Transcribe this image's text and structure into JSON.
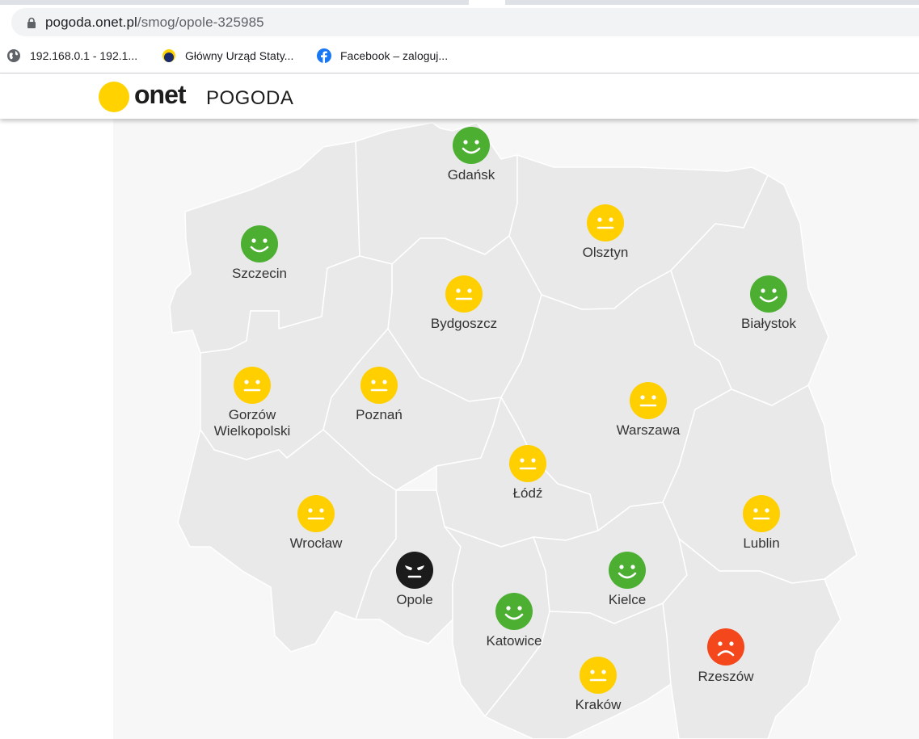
{
  "browser": {
    "url_host": "pogoda.onet.pl",
    "url_path": "/smog/opole-325985",
    "bookmarks": [
      {
        "label": "192.168.0.1 - 192.1...",
        "icon": "globe-icon"
      },
      {
        "label": "Główny Urząd Staty...",
        "icon": "gus-logo-icon"
      },
      {
        "label": "Facebook – zaloguj...",
        "icon": "facebook-icon"
      }
    ]
  },
  "header": {
    "logo_text": "onet",
    "section_title": "POGODA"
  },
  "colors": {
    "good": "#4caf32",
    "moderate": "#ffcf00",
    "bad": "#f4471c",
    "very_bad": "#1b1b1b",
    "map_fill": "#e9e9e9",
    "map_border": "#ffffff"
  },
  "map": {
    "cities": [
      {
        "id": "gdansk",
        "name": "Gdańsk",
        "quality": "good"
      },
      {
        "id": "olsztyn",
        "name": "Olsztyn",
        "quality": "moderate"
      },
      {
        "id": "szczecin",
        "name": "Szczecin",
        "quality": "good"
      },
      {
        "id": "bydgoszcz",
        "name": "Bydgoszcz",
        "quality": "moderate"
      },
      {
        "id": "bialystok",
        "name": "Białystok",
        "quality": "good"
      },
      {
        "id": "gorzow",
        "name": "Gorzów Wielkopolski",
        "quality": "moderate"
      },
      {
        "id": "poznan",
        "name": "Poznań",
        "quality": "moderate"
      },
      {
        "id": "warszawa",
        "name": "Warszawa",
        "quality": "moderate"
      },
      {
        "id": "lodz",
        "name": "Łódź",
        "quality": "moderate"
      },
      {
        "id": "wroclaw",
        "name": "Wrocław",
        "quality": "moderate"
      },
      {
        "id": "lublin",
        "name": "Lublin",
        "quality": "moderate"
      },
      {
        "id": "opole",
        "name": "Opole",
        "quality": "very_bad"
      },
      {
        "id": "kielce",
        "name": "Kielce",
        "quality": "good"
      },
      {
        "id": "katowice",
        "name": "Katowice",
        "quality": "good"
      },
      {
        "id": "rzeszow",
        "name": "Rzeszów",
        "quality": "bad"
      },
      {
        "id": "krakow",
        "name": "Kraków",
        "quality": "moderate"
      }
    ]
  }
}
